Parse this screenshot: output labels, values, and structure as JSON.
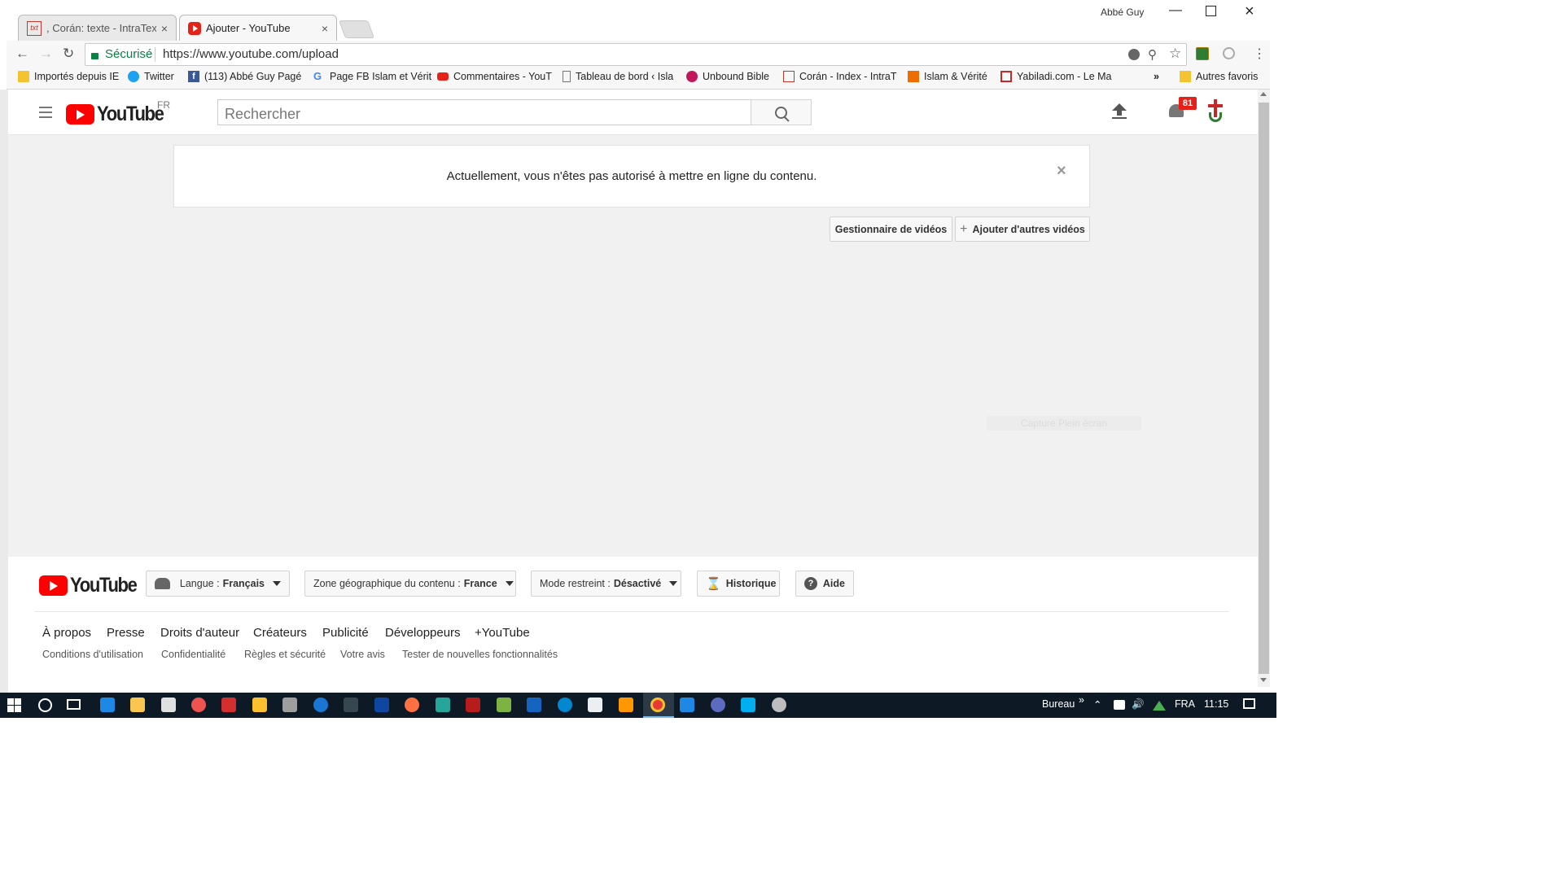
{
  "browser": {
    "tabs": [
      {
        "title": ", Corán: texte - IntraText C",
        "active": false
      },
      {
        "title": "Ajouter - YouTube",
        "active": true
      }
    ],
    "user_name": "Abbé Guy",
    "secure_label": "Sécurisé",
    "url": "https://www.youtube.com/upload",
    "bookmarks": [
      {
        "label": "Importés depuis IE",
        "icon": "folder-icon"
      },
      {
        "label": "Twitter",
        "icon": "twitter-icon"
      },
      {
        "label": "(113) Abbé Guy Pagé",
        "icon": "facebook-icon"
      },
      {
        "label": "Page FB Islam et Vérit",
        "icon": "google-icon"
      },
      {
        "label": "Commentaires - YouT",
        "icon": "youtube-icon"
      },
      {
        "label": "Tableau de bord ‹ Isla",
        "icon": "page-icon"
      },
      {
        "label": "Unbound Bible",
        "icon": "bible-icon"
      },
      {
        "label": "Corán - Index - IntraT",
        "icon": "intratext-icon"
      },
      {
        "label": "Islam & Vérité",
        "icon": "site-icon"
      },
      {
        "label": "Yabiladi.com - Le Ma",
        "icon": "yabiladi-icon"
      }
    ],
    "more_bookmarks": "»",
    "other_bookmarks": "Autres favoris"
  },
  "youtube": {
    "logo_text": "YouTube",
    "country_code": "FR",
    "search_placeholder": "Rechercher",
    "notification_count": "81",
    "banner_message": "Actuellement, vous n'êtes pas autorisé à mettre en ligne du contenu.",
    "close_glyph": "×",
    "video_manager_label": "Gestionnaire de vidéos",
    "add_more_label": "Ajouter d'autres vidéos",
    "add_more_glyph": "+",
    "watermark": "Capture Plein écran"
  },
  "footer": {
    "logo_text": "YouTube",
    "language_label": "Langue :",
    "language_value": "Français",
    "region_label": "Zone géographique du contenu :",
    "region_value": "France",
    "restricted_label": "Mode restreint :",
    "restricted_value": "Désactivé",
    "history_label": "Historique",
    "help_label": "Aide",
    "links_primary": [
      "À propos",
      "Presse",
      "Droits d'auteur",
      "Créateurs",
      "Publicité",
      "Développeurs",
      "+YouTube"
    ],
    "links_secondary": [
      "Conditions d'utilisation",
      "Confidentialité",
      "Règles et sécurité",
      "Votre avis",
      "Tester de nouvelles fonctionnalités"
    ]
  },
  "taskbar": {
    "desktop_label": "Bureau",
    "chevron": "»",
    "language": "FRA",
    "time": "11:15"
  },
  "colors": {
    "youtube_red": "#ff0000",
    "secure_green": "#0b8043",
    "notification_badge": "#e62117",
    "taskbar_bg": "#0d1a26"
  }
}
